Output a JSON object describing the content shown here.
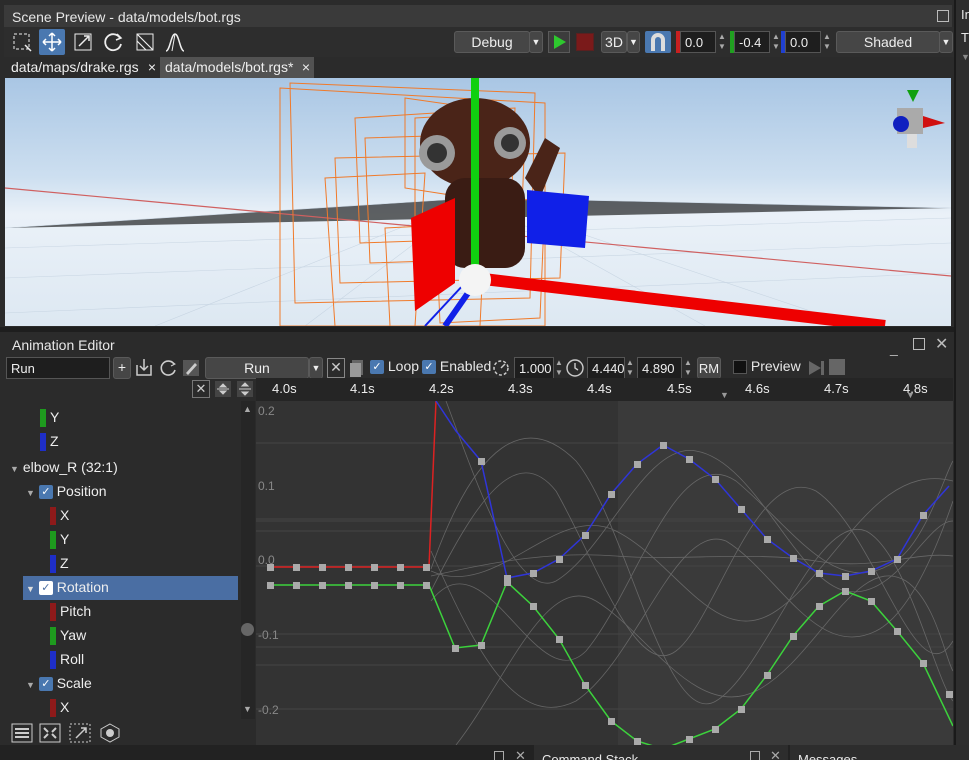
{
  "scene": {
    "title": "Scene Preview - data/models/bot.rgs",
    "mode_select": "Debug",
    "view_select": "3D",
    "x_value": "0.0",
    "y_value": "-0.4",
    "z_value": "0.0",
    "shading_select": "Shaded",
    "tabs": [
      {
        "label": "data/maps/drake.rgs"
      },
      {
        "label": "data/models/bot.rgs*"
      }
    ]
  },
  "right_panel": {
    "title_fragment": "In",
    "row_fragment": "T"
  },
  "anim": {
    "title": "Animation Editor",
    "name_value": "Run",
    "clip_select": "Run",
    "loop_label": "Loop",
    "enabled_label": "Enabled",
    "speed_value": "1.000",
    "start_value": "4.440",
    "end_value": "4.890",
    "rm_label": "RM",
    "preview_label": "Preview",
    "timeline": [
      "4.0s",
      "4.1s",
      "4.2s",
      "4.3s",
      "4.4s",
      "4.5s",
      "4.6s",
      "4.7s",
      "4.8s"
    ],
    "y_axis": [
      "0.2",
      "0.1",
      "0.0",
      "-0.1",
      "-0.2"
    ],
    "tree": [
      {
        "label": "Y",
        "color": "#1e9a1e"
      },
      {
        "label": "Z",
        "color": "#1e2ec8"
      },
      {
        "label": "elbow_R (32:1)"
      },
      {
        "label": "Position"
      },
      {
        "label": "X",
        "color": "#8e1a1a"
      },
      {
        "label": "Y",
        "color": "#1e9a1e"
      },
      {
        "label": "Z",
        "color": "#1e2ec8"
      },
      {
        "label": "Rotation"
      },
      {
        "label": "Pitch",
        "color": "#8e1a1a"
      },
      {
        "label": "Yaw",
        "color": "#1e9a1e"
      },
      {
        "label": "Roll",
        "color": "#1e2ec8"
      },
      {
        "label": "Scale"
      },
      {
        "label": "X",
        "color": "#8e1a1a"
      }
    ]
  },
  "bottom": {
    "panel2_fragment": "Command Stack",
    "panel3_fragment": "Messages"
  }
}
